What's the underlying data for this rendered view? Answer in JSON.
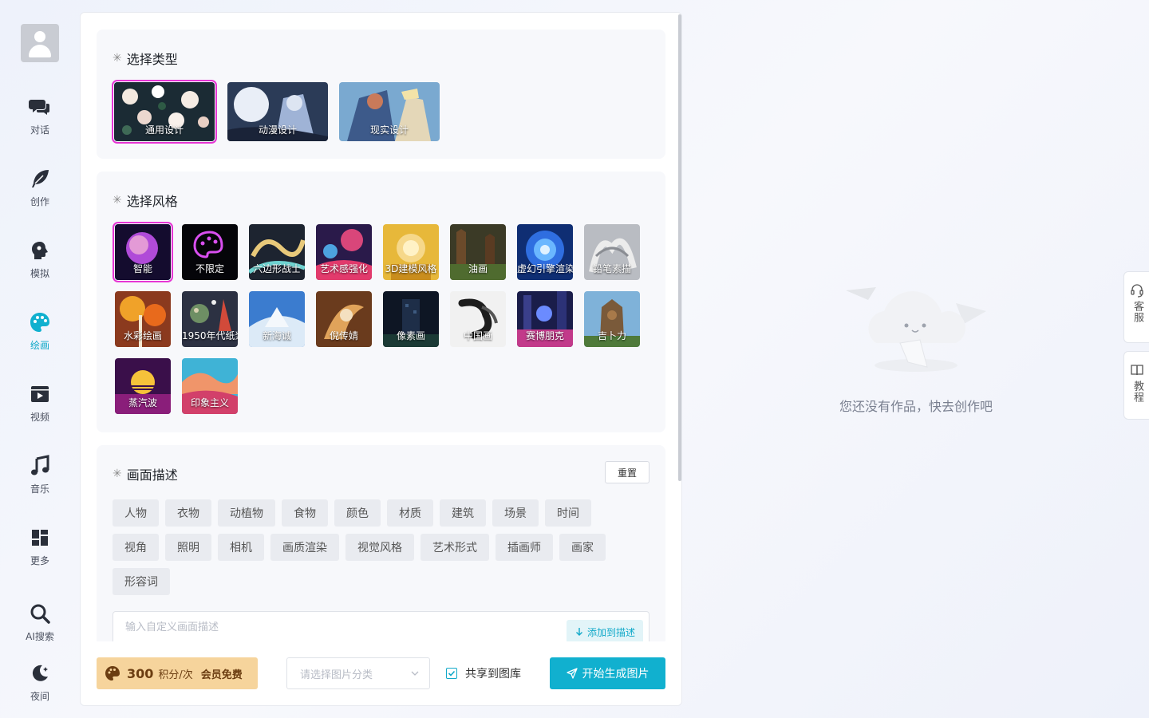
{
  "sidebar": {
    "items": [
      {
        "label": "对话",
        "icon": "chat-icon"
      },
      {
        "label": "创作",
        "icon": "feather-icon"
      },
      {
        "label": "模拟",
        "icon": "head-profile-icon"
      },
      {
        "label": "绘画",
        "icon": "palette-icon"
      },
      {
        "label": "视频",
        "icon": "video-icon"
      },
      {
        "label": "音乐",
        "icon": "music-note-icon"
      },
      {
        "label": "更多",
        "icon": "grid-icon"
      },
      {
        "label": "AI搜索",
        "icon": "search-icon"
      },
      {
        "label": "夜间",
        "icon": "moon-icon"
      }
    ],
    "active": "绘画"
  },
  "type_section": {
    "title": "选择类型",
    "options": [
      {
        "label": "通用设计",
        "selected": true
      },
      {
        "label": "动漫设计",
        "selected": false
      },
      {
        "label": "现实设计",
        "selected": false
      }
    ]
  },
  "style_section": {
    "title": "选择风格",
    "options": [
      {
        "label": "智能",
        "selected": true
      },
      {
        "label": "不限定"
      },
      {
        "label": "六边形战士"
      },
      {
        "label": "艺术感强化"
      },
      {
        "label": "3D建模风格"
      },
      {
        "label": "油画"
      },
      {
        "label": "虚幻引擎渲染"
      },
      {
        "label": "铅笔素描"
      },
      {
        "label": "水彩绘画"
      },
      {
        "label": "1950年代纸浆"
      },
      {
        "label": "新海诚"
      },
      {
        "label": "倪传婧"
      },
      {
        "label": "像素画"
      },
      {
        "label": "中国画"
      },
      {
        "label": "赛博朋克"
      },
      {
        "label": "吉卜力"
      },
      {
        "label": "蒸汽波"
      },
      {
        "label": "印象主义"
      }
    ]
  },
  "desc_section": {
    "title": "画面描述",
    "reset_label": "重置",
    "tags": [
      "人物",
      "衣物",
      "动植物",
      "食物",
      "颜色",
      "材质",
      "建筑",
      "场景",
      "时间",
      "视角",
      "照明",
      "相机",
      "画质渲染",
      "视觉风格",
      "艺术形式",
      "插画师",
      "画家",
      "形容词"
    ],
    "input_placeholder": "输入自定义画面描述",
    "add_label": "添加到描述"
  },
  "bottom": {
    "points_value": "300",
    "points_unit": "积分/次",
    "member_free": "会员免费",
    "category_placeholder": "请选择图片分类",
    "share_label": "共享到图库",
    "share_checked": true,
    "generate_label": "开始生成图片"
  },
  "empty_state": {
    "text": "您还没有作品，快去创作吧"
  },
  "side_tabs": {
    "service": "客服",
    "tutorial": "教程"
  },
  "colors": {
    "accent": "#11b0cf",
    "selected_outline": "#e635d4",
    "points_bg": "#f6d49c"
  }
}
